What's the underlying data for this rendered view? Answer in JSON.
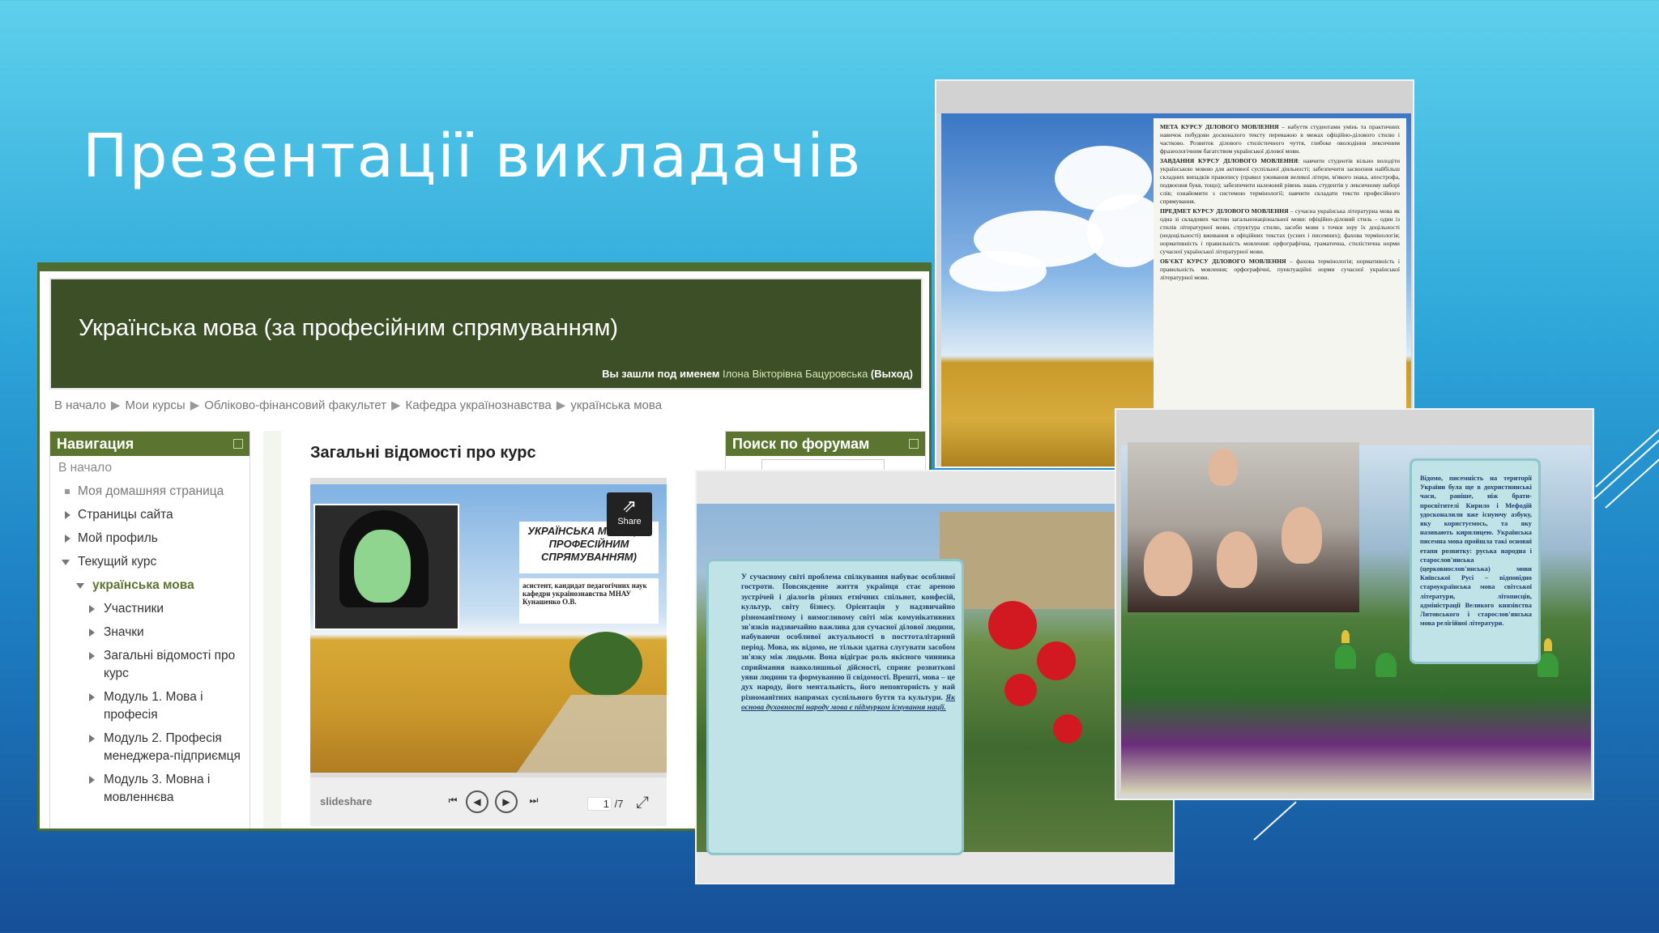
{
  "slide": {
    "title": "Презентації викладачів"
  },
  "moodle": {
    "course_title": "Українська мова (за професійним спрямуванням)",
    "login_prefix": "Вы зашли под именем",
    "login_user": "Ілона Вікторівна Бацуровська",
    "logout": "(Выход)",
    "breadcrumb": [
      "В начало",
      "Мои курсы",
      "Обліково-фінансовий факультет",
      "Кафедра українознавства",
      "українська мова"
    ],
    "navigation": {
      "title": "Навигация",
      "items": [
        "В начало",
        "Моя домашняя страница",
        "Страницы сайта",
        "Мой профиль",
        "Текущий курс",
        "українська мова",
        "Участники",
        "Значки",
        "Загальні відомості про курс",
        "Модуль 1. Мова і професія",
        "Модуль 2. Професія менеджера-підприємця",
        "Модуль 3. Мовна і мовленнєва"
      ]
    },
    "main_title": "Загальні відомості про курс",
    "slideshare": {
      "share_label": "Share",
      "slide_title": "УКРАЇНСЬКА МОВА (ЗА ПРОФЕСІЙНИМ СПРЯМУВАННЯМ)",
      "slide_author": "асистент, кандидат педагогічних наук кафедри українознавства МНАУ Кунашенко О.В.",
      "logo": "slideshare",
      "page_current": "1",
      "page_total": "/7"
    },
    "forum_title": "Поиск по форумам"
  },
  "doc": {
    "lines": [
      [
        "МЕТА КУРСУ ДІЛОВОГО МОВЛЕННЯ",
        " – набуття студентами умінь та практичних навичок побудови досконалого тексту переважно в межах офіційно-ділового стилю і частково. Розвиток ділового стилістичного чуття, глибоке оволодіння лексичним фразеологічним багатством української ділової мови."
      ],
      [
        "ЗАВДАННЯ КУРСУ ДІЛОВОГО МОВЛЕННЯ",
        ": навчити студентів вільно володіти українською мовою для активної суспільної діяльності; забезпечити засвоєння найбільш складних випадків правопису (правил уживання великої літери, м'якого знака, апострофа, подвоєння букв, тощо); забезпечити належний рівень знань студентів у лексичному наборі слів; ознайомити з системою термінології; навчити складати тексти професійного спрямування."
      ],
      [
        "ПРЕДМЕТ КУРСУ ДІЛОВОГО МОВЛЕННЯ",
        " – сучасна українська літературна мова як одна зі складових частин загальнонаціональної мови: офіційно-діловий стиль – один із стилів літературної мови, структура стилю, засоби мови з точки зору їх доцільності (недоцільності) вживання в офіційних текстах (усних і писемних); фахова термінологія; нормативність і правильність мовлення: орфографічна, граматична, стилістична норми сучасної української літературної мови."
      ],
      [
        "ОБ'ЄКТ КУРСУ ДІЛОВОГО МОВЛЕННЯ",
        " – фахова термінологія; нормативність і правильність мовлення; орфографічні, пунктуаційні норми сучасної української літературної мови."
      ]
    ]
  },
  "scroll": {
    "text": "У сучасному світі проблема спілкування набуває особливої гостроти. Повсякденне життя українця стає ареною зустрічей і діалогів різних етнічних спільнот, конфесій, культур, світу бізнесу. Орієнтація у надзвичайно різноманітному і вимогливому світі між комунікативних зв'язків надзвичайно важлива для сучасної ділової людини, набуваючи особливої актуальності в посттоталітарний період. Мова, як відомо, не тільки здатна слугувати засобом зв'язку між людьми. Вона відіграє роль якісного чинника сприймання навколишньої дійсності, сприяє розвиткові уяви людини та формуванню її свідомості. Врешті, мова – це дух народу, його ментальність, його неповторність у най різноманітних напрямах суспільного буття та культури.",
    "emphasis": "Як основа духовності народу мова є підмурком існування нації."
  },
  "kyiv": {
    "text": "Відомо, писемність на території України була ще в дохристиянські часи, раніше, ніж брати-просвітителі Кирило і Мефодій удосконалили вже існуючу азбуку, яку користуємось, та яку називають кирилицею. Українська писемна мова пройшла такі основні етапи розвитку: руська народна і старослов'янська (церковнослов'янська) мови Київської Русі – відповідно староукраїнська мова світської літератури, літописців, адміністрації Великого князівства Литовського і старослов'янська мова релігійної літератури."
  }
}
